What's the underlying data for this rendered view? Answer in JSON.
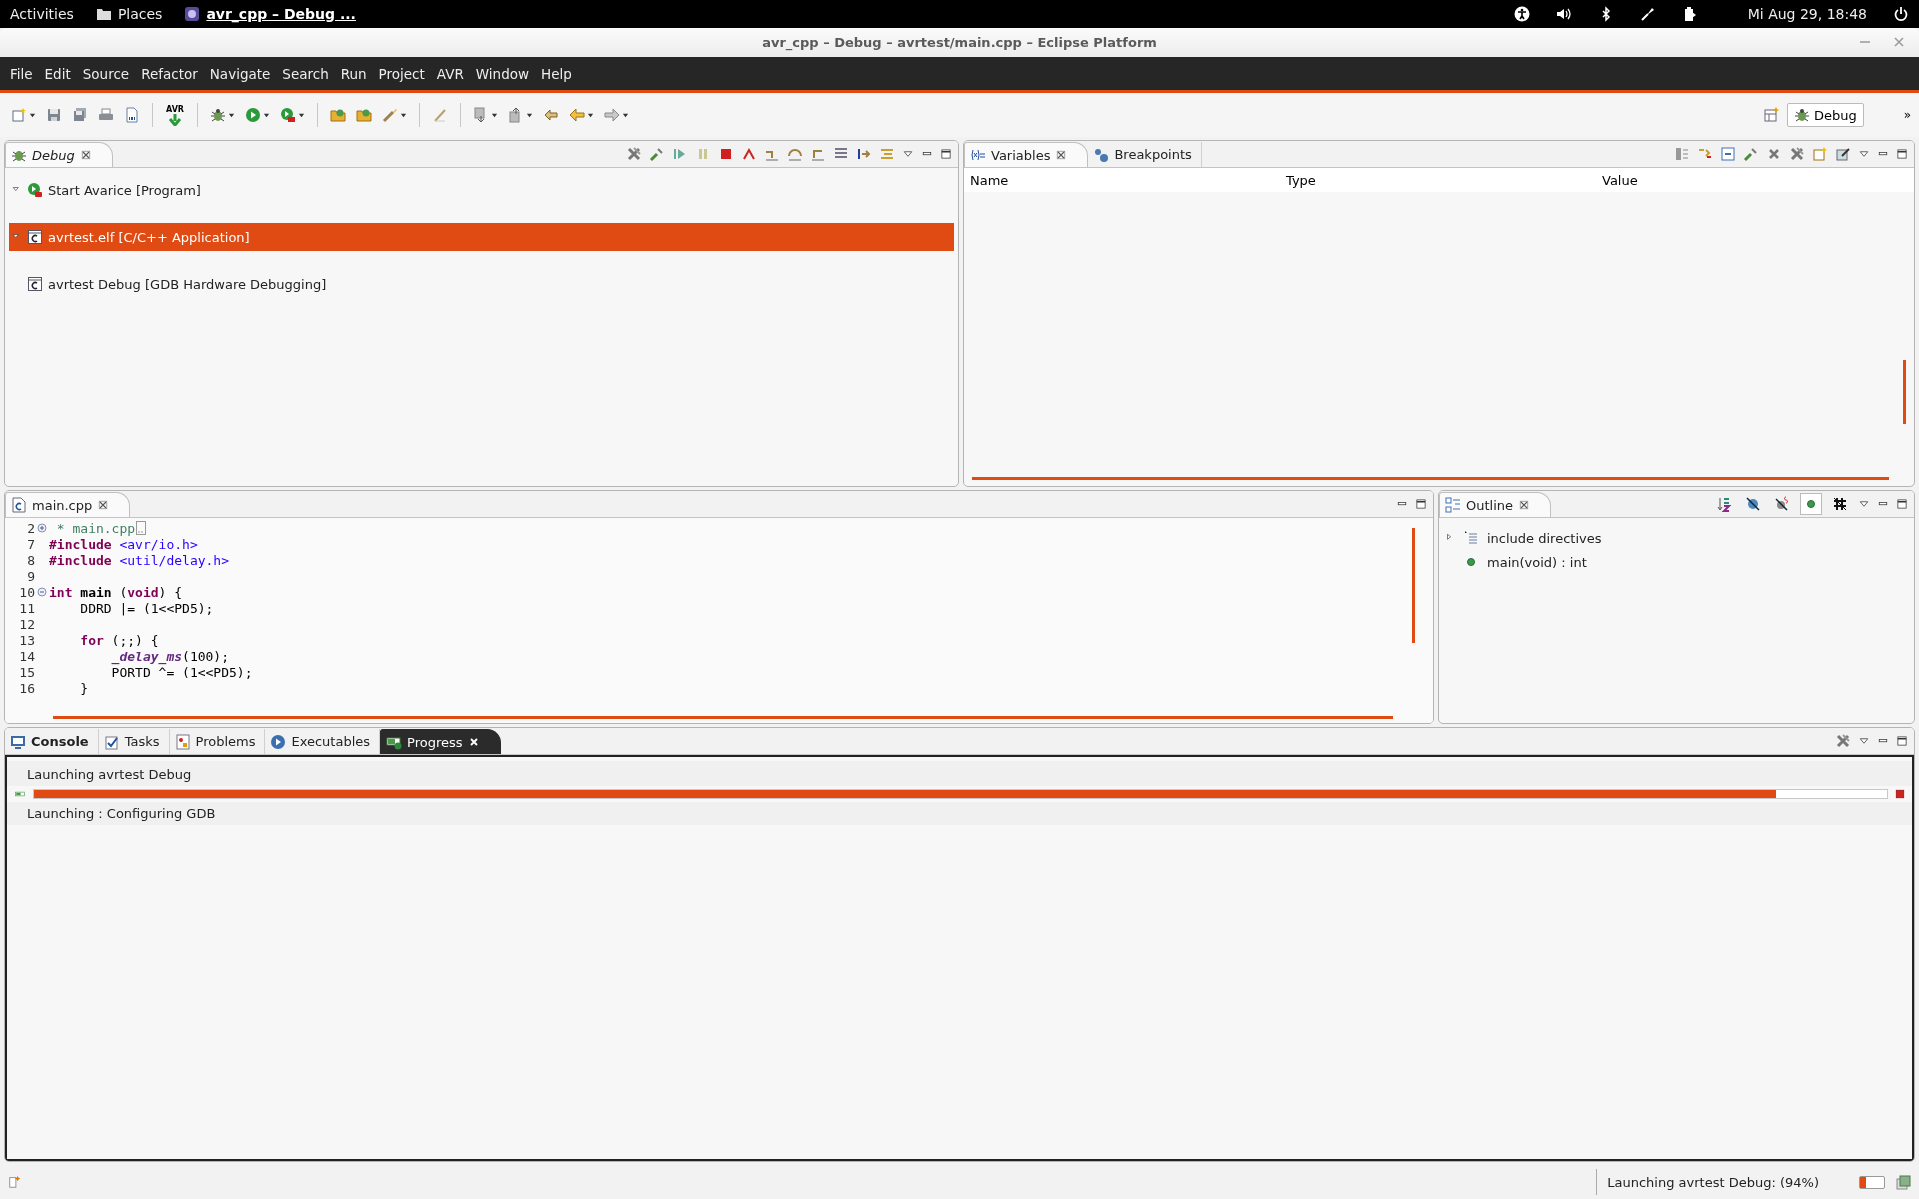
{
  "top_bar": {
    "activities": "Activities",
    "places": "Places",
    "app": "avr_cpp – Debug ...",
    "clock": "Mi Aug 29, 18:48"
  },
  "window": {
    "title": "avr_cpp – Debug – avrtest/main.cpp – Eclipse Platform"
  },
  "menu": [
    "File",
    "Edit",
    "Source",
    "Refactor",
    "Navigate",
    "Search",
    "Run",
    "Project",
    "AVR",
    "Window",
    "Help"
  ],
  "toolbar": {
    "avr_label": "AVR"
  },
  "perspectives": {
    "items": [
      {
        "label": "Debug",
        "selected": true
      }
    ],
    "more": "»"
  },
  "debug_view": {
    "active": false,
    "tabs": [
      {
        "kind": "debug",
        "label": "Debug",
        "selected": true
      }
    ],
    "tree": [
      {
        "kind": "launch",
        "label": "Start Avarice [Program]",
        "expanded": true,
        "selected": false
      },
      {
        "kind": "application",
        "label": "avrtest.elf [C/C++ Application]",
        "expanded": true,
        "selected": true
      },
      {
        "kind": "application",
        "label": "avrtest Debug [GDB Hardware Debugging]",
        "selected": false
      }
    ]
  },
  "variables_view": {
    "active": false,
    "tabs": [
      {
        "kind": "variables",
        "label": "Variables",
        "selected": true
      },
      {
        "kind": "breakpoints",
        "label": "Breakpoints",
        "selected": false
      }
    ],
    "columns": [
      "Name",
      "Type",
      "Value"
    ]
  },
  "editor": {
    "active": false,
    "tabs": [
      {
        "kind": "cfile",
        "label": "main.cpp",
        "selected": true
      }
    ],
    "lines": [
      {
        "number": "2",
        "folded": true,
        "tokens": [
          {
            "kind": "comment",
            "text": " * main.cpp"
          }
        ]
      },
      {
        "number": "7",
        "tokens": [
          {
            "kind": "keyword",
            "text": "#include"
          },
          {
            "kind": "include",
            "text": " <avr/io.h>"
          }
        ]
      },
      {
        "number": "8",
        "tokens": [
          {
            "kind": "keyword",
            "text": "#include"
          },
          {
            "kind": "include",
            "text": " <util/delay.h>"
          }
        ]
      },
      {
        "number": "9"
      },
      {
        "number": "10",
        "folded": false,
        "tokens": [
          {
            "kind": "keyword",
            "text": "int"
          },
          {
            "kind": "declaration",
            "text": " main"
          },
          {
            "kind": "plain",
            "text": " ("
          },
          {
            "kind": "keyword",
            "text": "void"
          },
          {
            "kind": "plain",
            "text": ") {"
          }
        ]
      },
      {
        "number": "11",
        "tokens": [
          {
            "kind": "plain",
            "text": "    DDRD |= (1<<PD5);"
          }
        ]
      },
      {
        "number": "12"
      },
      {
        "number": "13",
        "tokens": [
          {
            "kind": "keyword",
            "text": "    for"
          },
          {
            "kind": "plain",
            "text": " (;;) {"
          }
        ]
      },
      {
        "number": "14",
        "tokens": [
          {
            "kind": "function",
            "text": "        _delay_ms"
          },
          {
            "kind": "plain",
            "text": "(100);"
          }
        ]
      },
      {
        "number": "15",
        "tokens": [
          {
            "kind": "plain",
            "text": "        PORTD ^= (1<<PD5);"
          }
        ]
      },
      {
        "number": "16",
        "tokens": [
          {
            "kind": "plain",
            "text": "    }"
          }
        ]
      }
    ]
  },
  "outline": {
    "active": false,
    "tabs": [
      {
        "kind": "outline",
        "label": "Outline",
        "selected": true
      }
    ],
    "filters": [
      {
        "kind": "sort",
        "on": false
      },
      {
        "kind": "hide-fields",
        "on": false
      },
      {
        "kind": "hide-static",
        "on": false
      },
      {
        "kind": "hide-non-public",
        "on": true
      },
      {
        "kind": "hide-macros",
        "on": false
      }
    ],
    "items": [
      {
        "kind": "includes",
        "label": "include directives",
        "expanded": false
      },
      {
        "kind": "function",
        "label": "main(void) : int"
      }
    ]
  },
  "bottom_panel": {
    "active": true,
    "tabs": [
      {
        "kind": "console",
        "label": "Console",
        "selected": false,
        "bold": true
      },
      {
        "kind": "tasks",
        "label": "Tasks",
        "selected": false,
        "bold": false
      },
      {
        "kind": "problems",
        "label": "Problems",
        "selected": false,
        "bold": false
      },
      {
        "kind": "executables",
        "label": "Executables",
        "selected": false,
        "bold": false
      },
      {
        "kind": "progress",
        "label": "Progress",
        "selected": true,
        "bold": false
      }
    ],
    "jobs": [
      {
        "title": "Launching avrtest Debug",
        "level": 0.94,
        "status": "Launching : Configuring GDB"
      }
    ]
  },
  "status_bar": {
    "message": "Launching avrtest Debug: (94%)",
    "level": 0.25
  }
}
